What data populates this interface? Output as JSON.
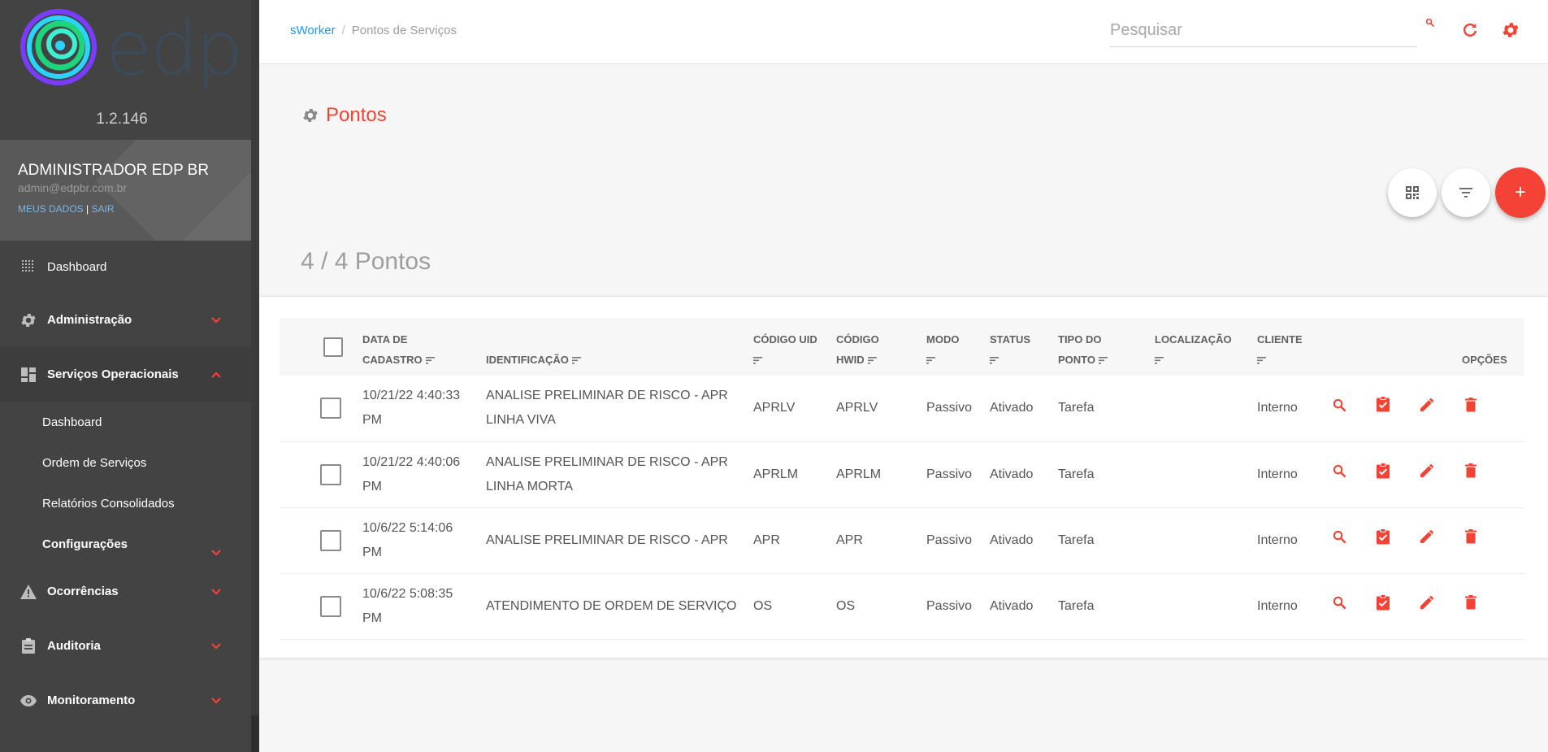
{
  "sidebar": {
    "brand_text": "edp",
    "version": "1.2.146",
    "user": {
      "name": "ADMINISTRADOR EDP BR",
      "email": "admin@edpbr.com.br",
      "my_data": "MEUS DADOS",
      "separator": "|",
      "logout": "SAIR"
    },
    "items": [
      {
        "label": "Dashboard",
        "icon": "grid-dots-icon"
      },
      {
        "label": "Administração",
        "icon": "gear-icon"
      },
      {
        "label": "Serviços Operacionais",
        "icon": "dashboard-icon"
      },
      {
        "label": "Ocorrências",
        "icon": "warning-icon"
      },
      {
        "label": "Auditoria",
        "icon": "clipboard-icon"
      },
      {
        "label": "Monitoramento",
        "icon": "eye-icon"
      }
    ],
    "subitems": [
      "Dashboard",
      "Ordem de Serviços",
      "Relatórios Consolidados",
      "Configurações"
    ]
  },
  "topbar": {
    "breadcrumb": {
      "home": "sWorker",
      "separator": "/",
      "current": "Pontos de Serviços"
    },
    "search_placeholder": "Pesquisar"
  },
  "page": {
    "title": "Pontos",
    "count": "4 / 4 Pontos",
    "add_label": "+"
  },
  "table": {
    "headers": {
      "date": [
        "DATA DE",
        "CADASTRO"
      ],
      "ident": "IDENTIFICAÇÃO",
      "uid": "CÓDIGO UID",
      "hwid": [
        "CÓDIGO",
        "HWID"
      ],
      "mode": "MODO",
      "status": "STATUS",
      "type": [
        "TIPO DO",
        "PONTO"
      ],
      "loc": "LOCALIZAÇÃO",
      "client": "CLIENTE",
      "options": "OPÇÕES"
    },
    "rows": [
      {
        "date": [
          "10/21/22 4:40:33",
          "PM"
        ],
        "ident": [
          "ANALISE PRELIMINAR DE RISCO - APR",
          "LINHA VIVA"
        ],
        "uid": "APRLV",
        "hwid": "APRLV",
        "mode": "Passivo",
        "status": "Ativado",
        "type": "Tarefa",
        "loc": "",
        "client": "Interno"
      },
      {
        "date": [
          "10/21/22 4:40:06",
          "PM"
        ],
        "ident": [
          "ANALISE PRELIMINAR DE RISCO - APR",
          "LINHA MORTA"
        ],
        "uid": "APRLM",
        "hwid": "APRLM",
        "mode": "Passivo",
        "status": "Ativado",
        "type": "Tarefa",
        "loc": "",
        "client": "Interno"
      },
      {
        "date": [
          "10/6/22 5:14:06",
          "PM"
        ],
        "ident": [
          "ANALISE PRELIMINAR DE RISCO - APR",
          ""
        ],
        "uid": "APR",
        "hwid": "APR",
        "mode": "Passivo",
        "status": "Ativado",
        "type": "Tarefa",
        "loc": "",
        "client": "Interno"
      },
      {
        "date": [
          "10/6/22 5:08:35",
          "PM"
        ],
        "ident": [
          "ATENDIMENTO DE ORDEM DE SERVIÇO",
          ""
        ],
        "uid": "OS",
        "hwid": "OS",
        "mode": "Passivo",
        "status": "Ativado",
        "type": "Tarefa",
        "loc": "",
        "client": "Interno"
      }
    ]
  },
  "colors": {
    "accent": "#f44336",
    "link": "#2196f3",
    "sidebar_bg": "#434343"
  }
}
